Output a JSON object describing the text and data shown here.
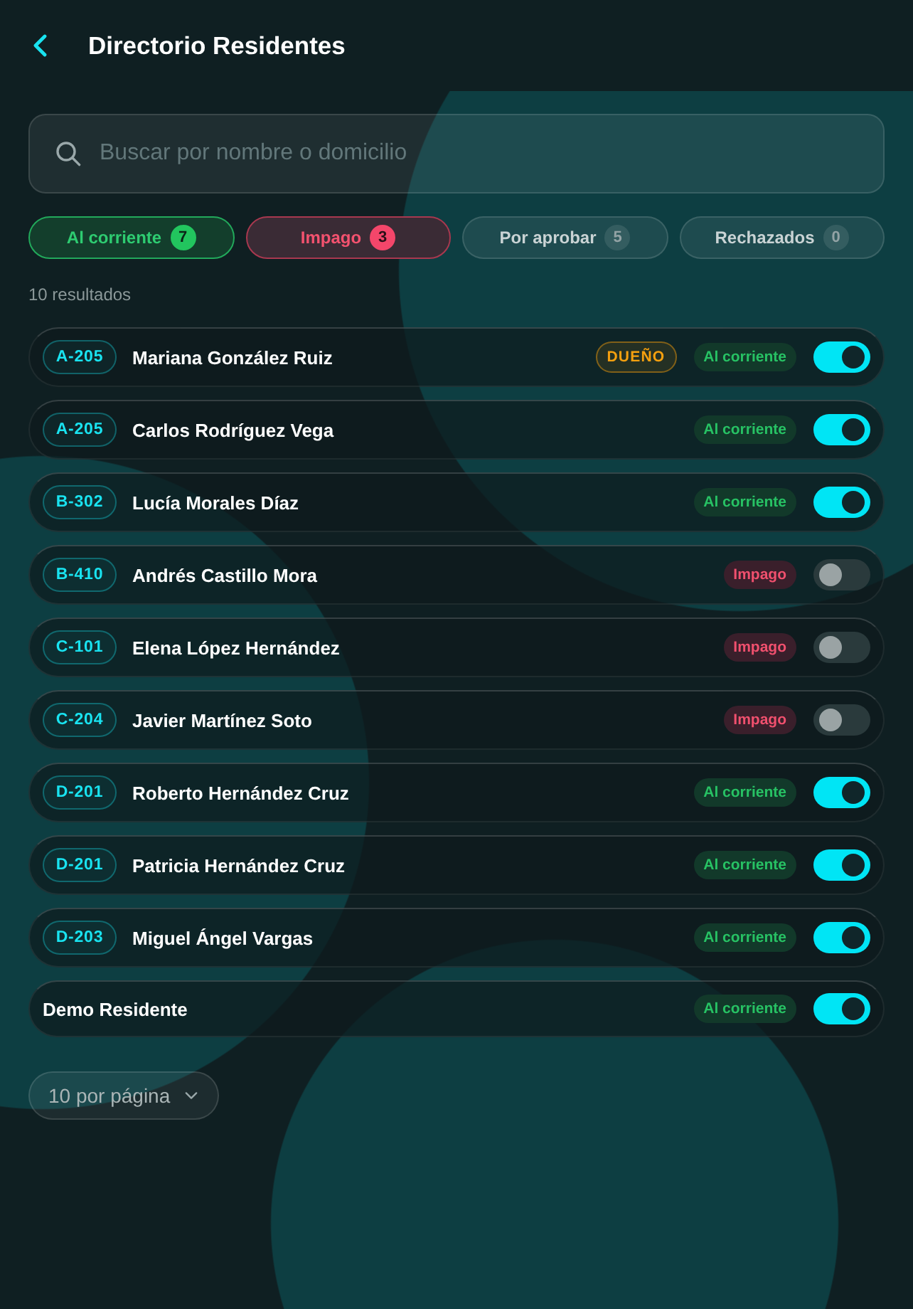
{
  "header": {
    "title": "Directorio Residentes"
  },
  "search": {
    "placeholder": "Buscar por nombre o domicilio"
  },
  "filters": [
    {
      "label": "Al corriente",
      "count": "7",
      "kind": "success"
    },
    {
      "label": "Impago",
      "count": "3",
      "kind": "danger"
    },
    {
      "label": "Por aprobar",
      "count": "5",
      "kind": "neutral"
    },
    {
      "label": "Rechazados",
      "count": "0",
      "kind": "neutral"
    }
  ],
  "results_label": "10 resultados",
  "residents": [
    {
      "unit": "A-205",
      "name": "Mariana González Ruiz",
      "role": "DUEÑO",
      "status": {
        "label": "Al corriente",
        "kind": "current"
      },
      "active": true
    },
    {
      "unit": "A-205",
      "name": "Carlos Rodríguez Vega",
      "status": {
        "label": "Al corriente",
        "kind": "current"
      },
      "active": true
    },
    {
      "unit": "B-302",
      "name": "Lucía Morales Díaz",
      "status": {
        "label": "Al corriente",
        "kind": "current"
      },
      "active": true
    },
    {
      "unit": "B-410",
      "name": "Andrés Castillo Mora",
      "status": {
        "label": "Impago",
        "kind": "unpaid"
      },
      "active": false
    },
    {
      "unit": "C-101",
      "name": "Elena López Hernández",
      "status": {
        "label": "Impago",
        "kind": "unpaid"
      },
      "active": false
    },
    {
      "unit": "C-204",
      "name": "Javier Martínez Soto",
      "status": {
        "label": "Impago",
        "kind": "unpaid"
      },
      "active": false
    },
    {
      "unit": "D-201",
      "name": "Roberto Hernández Cruz",
      "status": {
        "label": "Al corriente",
        "kind": "current"
      },
      "active": true
    },
    {
      "unit": "D-201",
      "name": "Patricia Hernández Cruz",
      "status": {
        "label": "Al corriente",
        "kind": "current"
      },
      "active": true
    },
    {
      "unit": "D-203",
      "name": "Miguel Ángel Vargas",
      "status": {
        "label": "Al corriente",
        "kind": "current"
      },
      "active": true
    },
    {
      "name": "Demo Residente",
      "status": {
        "label": "Al corriente",
        "kind": "current"
      },
      "active": true
    }
  ],
  "page_size": {
    "label": "10 por página"
  }
}
